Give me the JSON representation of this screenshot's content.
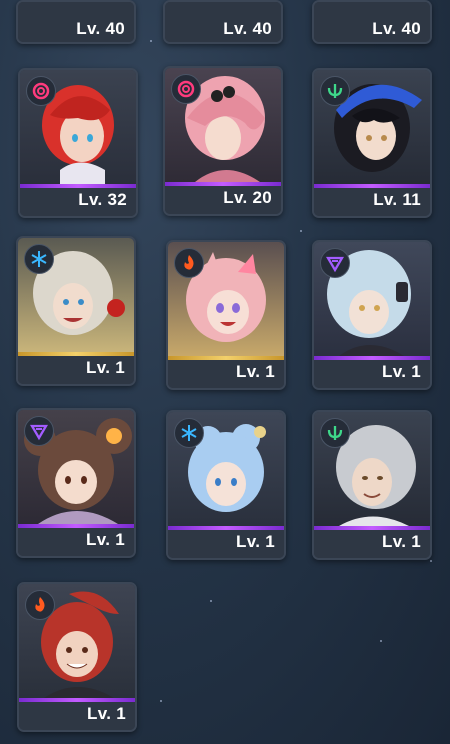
{
  "colors": {
    "purple_bar": "#a23cf0",
    "gold_bar": "#e4b73c",
    "chaos": "#ff3b7d",
    "frost": "#3ab7ff",
    "fire": "#ff5a1f",
    "wind": "#3ed88a",
    "void": "#a35cff"
  },
  "cards": [
    {
      "level": "Lv. 40",
      "partial": true
    },
    {
      "level": "Lv. 40",
      "partial": true
    },
    {
      "level": "Lv. 40",
      "partial": true
    },
    {
      "level": "Lv. 32",
      "element": "chaos-icon",
      "rarity": "purple",
      "hair": "#d9312b"
    },
    {
      "level": "Lv. 20",
      "element": "chaos-icon",
      "rarity": "purple",
      "hair": "#eea3b0"
    },
    {
      "level": "Lv. 11",
      "element": "wind-icon",
      "rarity": "purple",
      "hair": "#1b1b22"
    },
    {
      "level": "Lv. 1",
      "element": "frost-icon",
      "rarity": "gold",
      "hair": "#dcd7cc"
    },
    {
      "level": "Lv. 1",
      "element": "fire-icon",
      "rarity": "gold",
      "hair": "#f1b3b8"
    },
    {
      "level": "Lv. 1",
      "element": "void-icon",
      "rarity": "purple",
      "hair": "#c5dbe9"
    },
    {
      "level": "Lv. 1",
      "element": "void-icon",
      "rarity": "purple",
      "hair": "#6b4a3c"
    },
    {
      "level": "Lv. 1",
      "element": "frost-icon",
      "rarity": "purple",
      "hair": "#a9cdf1"
    },
    {
      "level": "Lv. 1",
      "element": "wind-icon",
      "rarity": "purple",
      "hair": "#c8cbd0"
    },
    {
      "level": "Lv. 1",
      "element": "fire-icon",
      "rarity": "purple",
      "hair": "#b8342a"
    }
  ]
}
